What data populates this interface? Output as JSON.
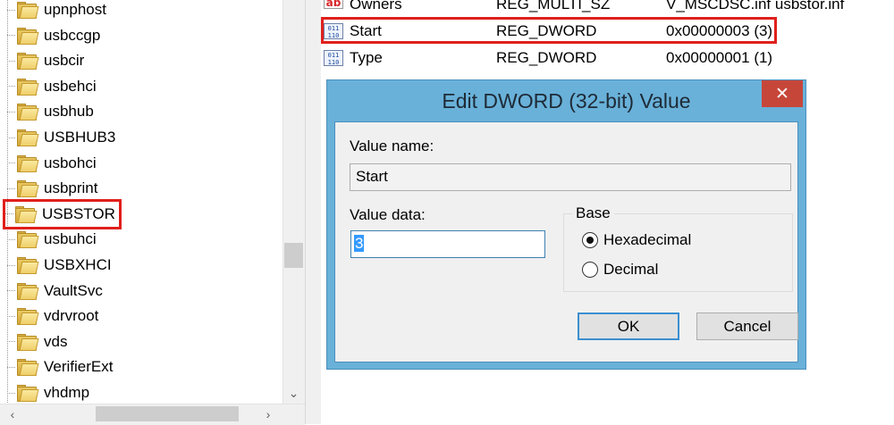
{
  "tree": {
    "items": [
      {
        "label": "upnphost"
      },
      {
        "label": "usbccgp"
      },
      {
        "label": "usbcir"
      },
      {
        "label": "usbehci"
      },
      {
        "label": "usbhub"
      },
      {
        "label": "USBHUB3"
      },
      {
        "label": "usbohci"
      },
      {
        "label": "usbprint"
      },
      {
        "label": "USBSTOR"
      },
      {
        "label": "usbuhci"
      },
      {
        "label": "USBXHCI"
      },
      {
        "label": "VaultSvc"
      },
      {
        "label": "vdrvroot"
      },
      {
        "label": "vds"
      },
      {
        "label": "VerifierExt"
      },
      {
        "label": "vhdmp"
      }
    ],
    "selected": "USBSTOR"
  },
  "values": {
    "rows": [
      {
        "name": "Owners",
        "type": "REG_MULTI_SZ",
        "data": "V_MSCDSC.inf usbstor.inf",
        "icon": "string-value-icon"
      },
      {
        "name": "Start",
        "type": "REG_DWORD",
        "data": "0x00000003 (3)",
        "icon": "binary-value-icon"
      },
      {
        "name": "Type",
        "type": "REG_DWORD",
        "data": "0x00000001 (1)",
        "icon": "binary-value-icon"
      }
    ]
  },
  "dialog": {
    "title": "Edit DWORD (32-bit) Value",
    "close_glyph": "✕",
    "value_name_label": "Value name:",
    "value_name": "Start",
    "value_data_label": "Value data:",
    "value_data": "3",
    "base_label": "Base",
    "hex_label": "Hexadecimal",
    "dec_label": "Decimal",
    "selected_base": "Hexadecimal",
    "ok_label": "OK",
    "cancel_label": "Cancel"
  },
  "scrollbar": {
    "down_glyph": "⌄",
    "left_glyph": "‹",
    "right_glyph": "›"
  },
  "colors": {
    "highlight": "#e0201c",
    "dialog_frame": "#69b1d9",
    "close_button": "#c7463a"
  }
}
